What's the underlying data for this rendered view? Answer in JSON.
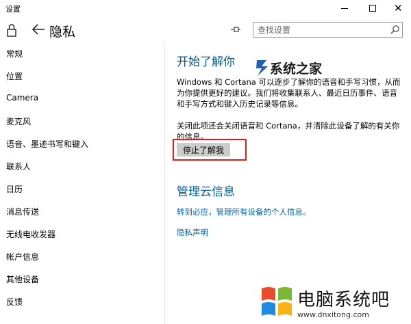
{
  "window": {
    "title": "设置"
  },
  "header": {
    "page_title": "隐私",
    "search_placeholder": "查找设置"
  },
  "sidebar": {
    "items": [
      {
        "label": "常规"
      },
      {
        "label": "位置"
      },
      {
        "label": "Camera"
      },
      {
        "label": "麦克风"
      },
      {
        "label": "语音、墨迹书写和键入"
      },
      {
        "label": "联系人"
      },
      {
        "label": "日历"
      },
      {
        "label": "消息传送"
      },
      {
        "label": "无线电收发器"
      },
      {
        "label": "帐户信息"
      },
      {
        "label": "其他设备"
      },
      {
        "label": "反馈"
      }
    ]
  },
  "content": {
    "section1_title": "开始了解你",
    "section1_desc": "Windows 和 Cortana 可以逐步了解你的语音和手写习惯，从而为你提供更好的建议。我们将收集联系人、最近日历事件、语音和手写方式和键入历史记录等信息。",
    "section1_note": "关闭此项还会关闭语音和 Cortana，并清除此设备了解的有关你的信息。",
    "stop_button": "停止了解我",
    "section2_title": "管理云信息",
    "cloud_link": "转到必应，管理所有设备的个人信息。",
    "privacy_link": "隐私声明"
  },
  "watermark": {
    "top_text": "系统之家",
    "bottom_text": "电脑系统吧",
    "bottom_url": "www.dnxitong.com"
  },
  "colors": {
    "accent": "#005a9e",
    "link": "#0063b1",
    "highlight_border": "#e01e1e",
    "button_bg": "#cccccc"
  }
}
